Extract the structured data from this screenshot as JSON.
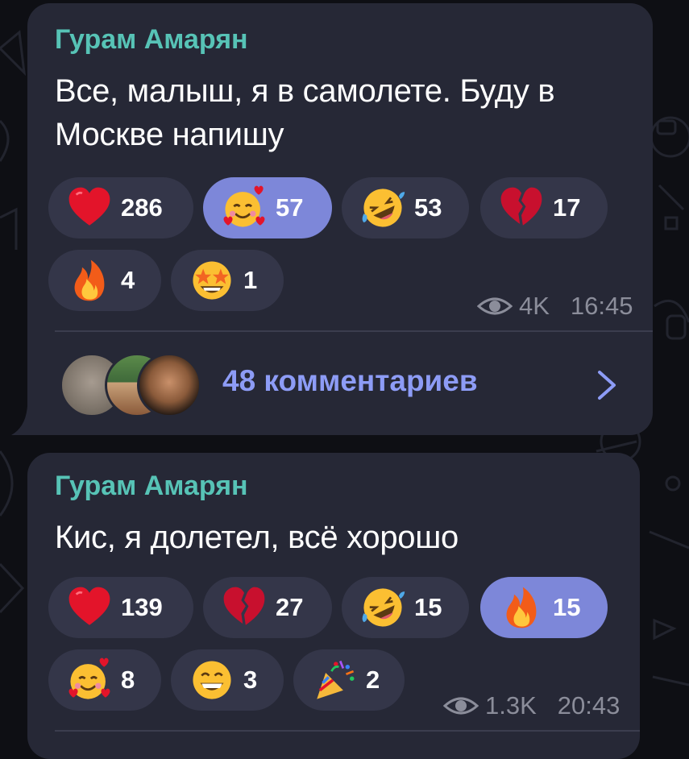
{
  "colors": {
    "background": "#0e0f14",
    "bubble": "#262836",
    "author": "#57c3b6",
    "reaction_pill": "#343649",
    "reaction_pill_active": "#7d87d9",
    "meta_text": "#8b8d9a",
    "comments_link": "#8d9cf6"
  },
  "posts": [
    {
      "author": "Гурам Амарян",
      "text_line1": "Все, малыш, я в самолете. Буду в",
      "text_line2": "Москве напишу",
      "reactions": [
        {
          "emoji": "red-heart",
          "count": "286",
          "active": false
        },
        {
          "emoji": "smiling-face-with-hearts",
          "count": "57",
          "active": true
        },
        {
          "emoji": "rolling-on-floor-laughing",
          "count": "53",
          "active": false
        },
        {
          "emoji": "broken-heart",
          "count": "17",
          "active": false
        },
        {
          "emoji": "fire",
          "count": "4",
          "active": false
        },
        {
          "emoji": "star-struck",
          "count": "1",
          "active": false
        }
      ],
      "views": "4K",
      "time": "16:45",
      "comments_label": "48 комментариев"
    },
    {
      "author": "Гурам Амарян",
      "text_line1": "Кис, я долетел, всё хорошо",
      "reactions": [
        {
          "emoji": "red-heart",
          "count": "139",
          "active": false
        },
        {
          "emoji": "broken-heart",
          "count": "27",
          "active": false
        },
        {
          "emoji": "rolling-on-floor-laughing",
          "count": "15",
          "active": false
        },
        {
          "emoji": "fire",
          "count": "15",
          "active": true
        },
        {
          "emoji": "smiling-face-with-hearts",
          "count": "8",
          "active": false
        },
        {
          "emoji": "beaming-face",
          "count": "3",
          "active": false
        },
        {
          "emoji": "party-popper",
          "count": "2",
          "active": false
        }
      ],
      "views": "1.3K",
      "time": "20:43"
    }
  ]
}
